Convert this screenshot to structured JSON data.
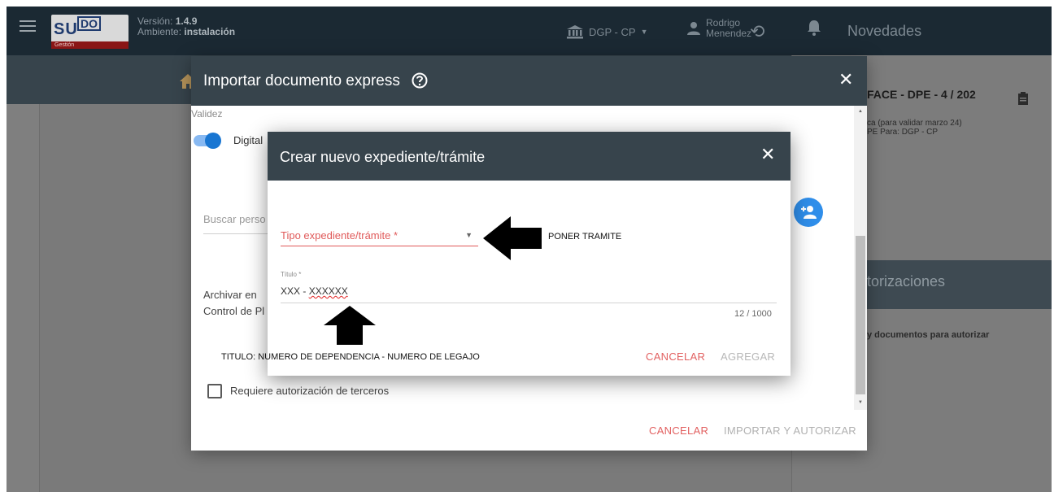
{
  "app": {
    "version_label": "Versión:",
    "version": "1.4.9",
    "env_label": "Ambiente:",
    "env": "instalación",
    "logo_su": "SU",
    "logo_do": "DO",
    "logo_sub": "Gestión",
    "dependency": "DGP - CP",
    "user_first": "Rodrigo",
    "user_last": "Menendez",
    "news": "Novedades"
  },
  "right_panel": {
    "doc_title": "FACE - DPE - 4 / 202",
    "doc_sub1": "ca (para validar marzo 24)",
    "doc_sub2": "PE Para: DGP - CP",
    "auth_title": "torizaciones",
    "auth_msg": "y documentos para autorizar"
  },
  "express_dialog": {
    "title": "Importar documento express",
    "validez_label": "Validez",
    "digital_label": "Digital",
    "search_placeholder": "Buscar perso",
    "archivar_label": "Archivar en",
    "control_value": "Control de Pl",
    "requires_auth_label": "Requiere autorización de terceros",
    "cancel_label": "CANCELAR",
    "import_label": "IMPORTAR Y AUTORIZAR"
  },
  "new_dialog": {
    "title": "Crear nuevo expediente/trámite",
    "tipo_label": "Tipo expediente/trámite *",
    "titulo_label": "Título *",
    "titulo_value_a": "XXX - ",
    "titulo_value_b": "XXXXXX",
    "counter": "12 / 1000",
    "cancel_label": "CANCELAR",
    "add_label": "AGREGAR"
  },
  "annotations": {
    "poner": "PONER TRAMITE",
    "titulo_hint": "TITULO: NUMERO DE DEPENDENCIA - NUMERO DE LEGAJO"
  },
  "colors": {
    "header": "#37444c",
    "accent_red": "#e05a5a",
    "accent_blue": "#1976d2"
  }
}
